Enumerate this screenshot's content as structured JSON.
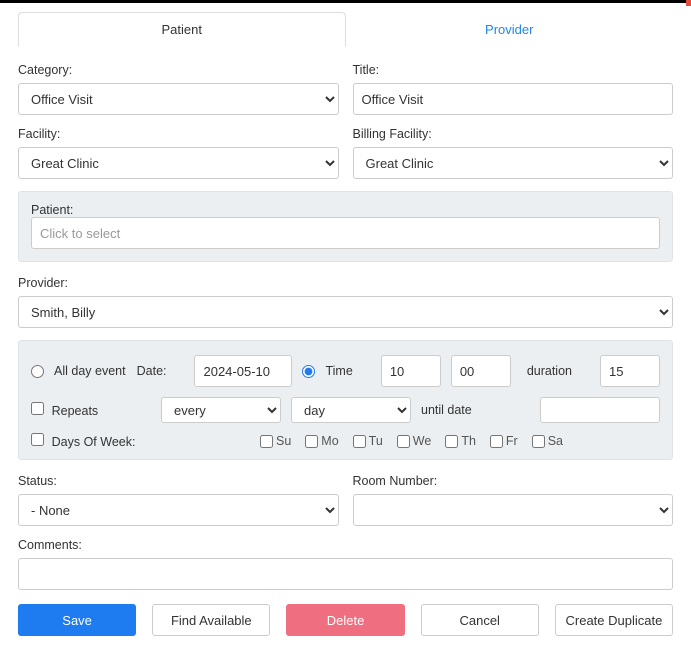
{
  "tabs": {
    "patient": "Patient",
    "provider": "Provider"
  },
  "labels": {
    "category": "Category:",
    "title": "Title:",
    "facility": "Facility:",
    "billingFacility": "Billing Facility:",
    "patient": "Patient:",
    "provider": "Provider:",
    "allDay": "All day event",
    "date": "Date:",
    "time": "Time",
    "duration": "duration",
    "repeats": "Repeats",
    "daysOfWeek": "Days Of Week:",
    "untilDate": "until date",
    "status": "Status:",
    "roomNumber": "Room Number:",
    "comments": "Comments:"
  },
  "values": {
    "category": "Office Visit",
    "title": "Office Visit",
    "facility": "Great Clinic",
    "billingFacility": "Great Clinic",
    "patientPlaceholder": "Click to select",
    "provider": "Smith, Billy",
    "date": "2024-05-10",
    "timeHour": "10",
    "timeMinute": "00",
    "duration": "15",
    "repeatFreq": "every",
    "repeatUnit": "day",
    "status": "- None",
    "roomNumber": "",
    "comments": ""
  },
  "days": {
    "su": "Su",
    "mo": "Mo",
    "tu": "Tu",
    "we": "We",
    "th": "Th",
    "fr": "Fr",
    "sa": "Sa"
  },
  "buttons": {
    "save": "Save",
    "findAvailable": "Find Available",
    "delete": "Delete",
    "cancel": "Cancel",
    "createDuplicate": "Create Duplicate"
  }
}
